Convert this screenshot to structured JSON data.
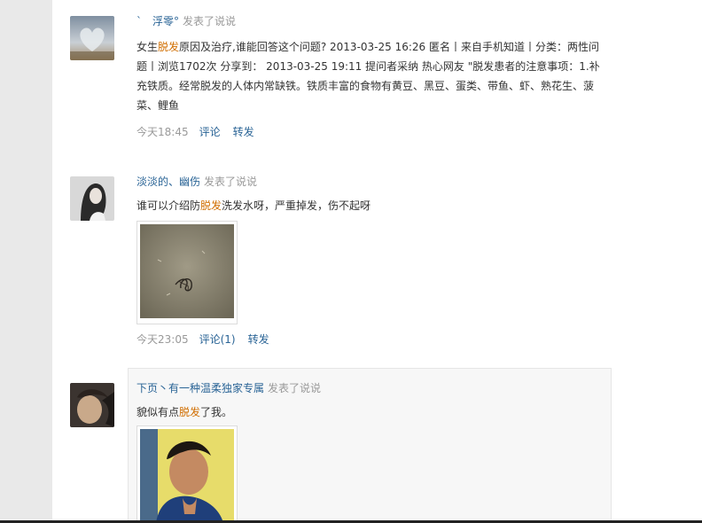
{
  "feed": [
    {
      "author": "ˋ　浮零°",
      "action": "发表了说说",
      "content_parts": [
        {
          "text": "女生",
          "kw": false
        },
        {
          "text": "脱发",
          "kw": true
        },
        {
          "text": "原因及治疗,谁能回答这个问题? 2013-03-25 16:26 匿名丨来自手机知道丨分类：两性问题丨浏览1702次 分享到： 2013-03-25 19:11 提问者采纳 热心网友 \"脱发患者的注意事项：1.补充铁质。经常脱发的人体内常缺铁。铁质丰富的食物有黄豆、黑豆、蛋类、带鱼、虾、熟花生、菠菜、鲤鱼",
          "kw": false
        }
      ],
      "time": "今天18:45",
      "comment_label": "评论",
      "forward_label": "转发"
    },
    {
      "author": "淡淡的、幽伤",
      "action": "发表了说说",
      "content_parts": [
        {
          "text": "谁可以介绍防",
          "kw": false
        },
        {
          "text": "脱发",
          "kw": true
        },
        {
          "text": "洗发水呀，严重掉发，伤不起呀",
          "kw": false
        }
      ],
      "time": "今天23:05",
      "comment_label": "评论(1)",
      "forward_label": "转发"
    },
    {
      "author": "下页丶有一种温柔独家专属",
      "action": "发表了说说",
      "content_parts": [
        {
          "text": "貌似有点",
          "kw": false
        },
        {
          "text": "脱发",
          "kw": true
        },
        {
          "text": "了我。",
          "kw": false
        }
      ]
    }
  ],
  "colors": {
    "author_link": "#2a6496",
    "keyword": "#d06e00",
    "muted": "#999999"
  }
}
